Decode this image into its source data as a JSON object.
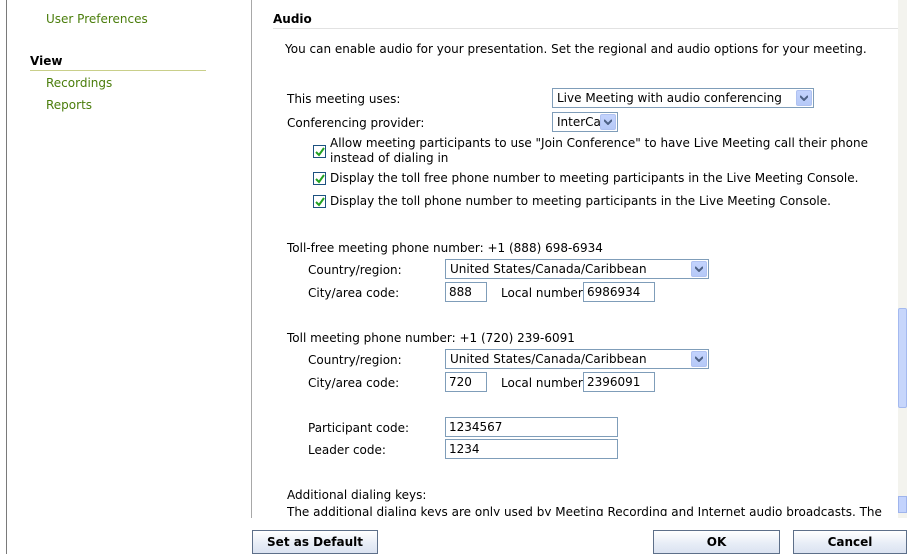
{
  "nav": {
    "user_preferences": "User Preferences",
    "view_heading": "View",
    "recordings": "Recordings",
    "reports": "Reports"
  },
  "audio": {
    "title": "Audio",
    "intro": "You can enable audio for your presentation. Set the regional and audio options for your meeting.",
    "meeting_uses_label": "This meeting uses:",
    "meeting_uses_value": "Live Meeting with audio conferencing",
    "provider_label": "Conferencing provider:",
    "provider_value": "InterCall",
    "checkbox_join_line1": "Allow meeting participants to use \"Join Conference\" to have Live Meeting call their phone",
    "checkbox_join_line2": "instead of dialing in",
    "checkbox_tollfree": "Display the toll free phone number to meeting participants in the Live Meeting Console.",
    "checkbox_toll": "Display the toll phone number to meeting participants in the Live Meeting Console."
  },
  "tollfree": {
    "heading": "Toll-free meeting phone number: +1 (888) 698-6934",
    "country_label": "Country/region:",
    "country_value": "United States/Canada/Caribbean",
    "city_label": "City/area code:",
    "city_value": "888",
    "local_label": "Local number:",
    "local_value": "6986934"
  },
  "toll": {
    "heading": "Toll meeting phone number: +1 (720) 239-6091",
    "country_label": "Country/region:",
    "country_value": "United States/Canada/Caribbean",
    "city_label": "City/area code:",
    "city_value": "720",
    "local_label": "Local number:",
    "local_value": "2396091"
  },
  "codes": {
    "participant_label": "Participant code:",
    "participant_value": "1234567",
    "leader_label": "Leader code:",
    "leader_value": "1234"
  },
  "additional": {
    "heading": "Additional dialing keys:",
    "text": "The additional dialing keys are only used by Meeting Recording and Internet audio broadcasts. The"
  },
  "buttons": {
    "set_default": "Set as Default",
    "ok": "OK",
    "cancel": "Cancel"
  },
  "colors": {
    "nav_link": "#4a7d0b",
    "input_border": "#7f9db9",
    "dropdown_arrow": "#4d6185",
    "checkbox_check": "#21a121"
  }
}
